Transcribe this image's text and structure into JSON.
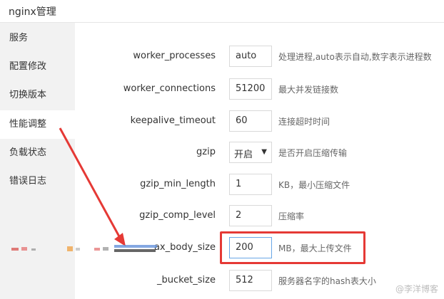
{
  "app": {
    "title": "nginx管理"
  },
  "sidebar": {
    "items": [
      {
        "label": "服务"
      },
      {
        "label": "配置修改"
      },
      {
        "label": "切换版本"
      },
      {
        "label": "性能调整"
      },
      {
        "label": "负载状态"
      },
      {
        "label": "错误日志"
      }
    ],
    "active_index": 3
  },
  "settings": [
    {
      "label": "worker_processes",
      "value": "auto",
      "desc": "处理进程,auto表示自动,数字表示进程数"
    },
    {
      "label": "worker_connections",
      "value": "51200",
      "desc": "最大并发链接数"
    },
    {
      "label": "keepalive_timeout",
      "value": "60",
      "desc": "连接超时时间"
    },
    {
      "label": "gzip",
      "value": "开启",
      "desc": "是否开启压缩传输"
    },
    {
      "label": "gzip_min_length",
      "value": "1",
      "desc": "KB，最小压缩文件"
    },
    {
      "label": "gzip_comp_level",
      "value": "2",
      "desc": "压缩率"
    },
    {
      "label": "client_max_body_size",
      "value": "200",
      "desc": "MB，最大上传文件"
    },
    {
      "label": "server_names_hash_bucket_size",
      "value": "512",
      "desc": "服务器名字的hash表大小"
    }
  ],
  "visible_labels": {
    "client_max_body_size": "ax_body_size",
    "server_names_hash_bucket_size": "_bucket_size"
  },
  "watermark": "@李洋博客",
  "colors": {
    "highlight": "#e53935",
    "arrow": "#e53935",
    "sidebar_bg": "#f2f2f2"
  }
}
